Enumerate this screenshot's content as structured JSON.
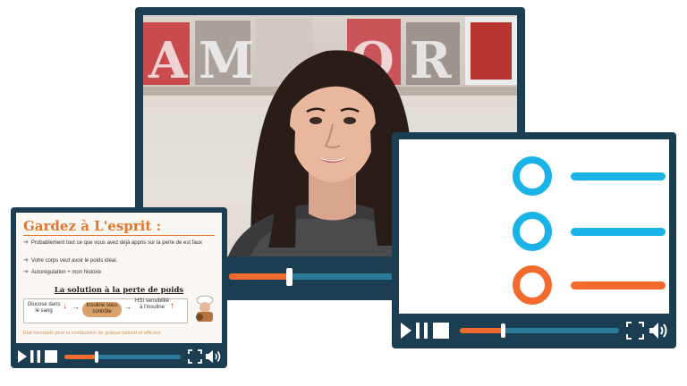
{
  "colors": {
    "frame": "#1b3e52",
    "accent": "#f26a2e",
    "track": "#2a7a9a",
    "list_blue": "#1ab3e8",
    "list_orange": "#f26a2e"
  },
  "main_player": {
    "letters": [
      "A",
      "M",
      "O",
      "R"
    ],
    "progress": 0.28,
    "icons": [
      "fullscreen-icon",
      "volume-icon"
    ]
  },
  "list_player": {
    "items": [
      {
        "color": "blue"
      },
      {
        "color": "blue"
      },
      {
        "color": "orange"
      }
    ],
    "progress": 0.27,
    "icons": [
      "play-icon",
      "pause-icon",
      "stop-icon",
      "fullscreen-icon",
      "volume-icon"
    ]
  },
  "slide_player": {
    "title": "Gardez à L'esprit :",
    "bullets": [
      "Probablement tout ce que vous avez déjà appris sur la perte de est faux",
      "Votre corps veut avoir le poids idéal.",
      "Autorégulation + mon histoire"
    ],
    "subtitle": "La solution à la perte de poids",
    "diagram": {
      "left": "Glucose dans le sang",
      "middle": "Insuline sous contrôle",
      "right": "HSI sensibilité à l'insuline"
    },
    "footer": "Etat favorable pour la combustion de graisse naturel et efficace",
    "progress": 0.27,
    "icons": [
      "play-icon",
      "pause-icon",
      "stop-icon",
      "fullscreen-icon",
      "volume-icon"
    ]
  }
}
